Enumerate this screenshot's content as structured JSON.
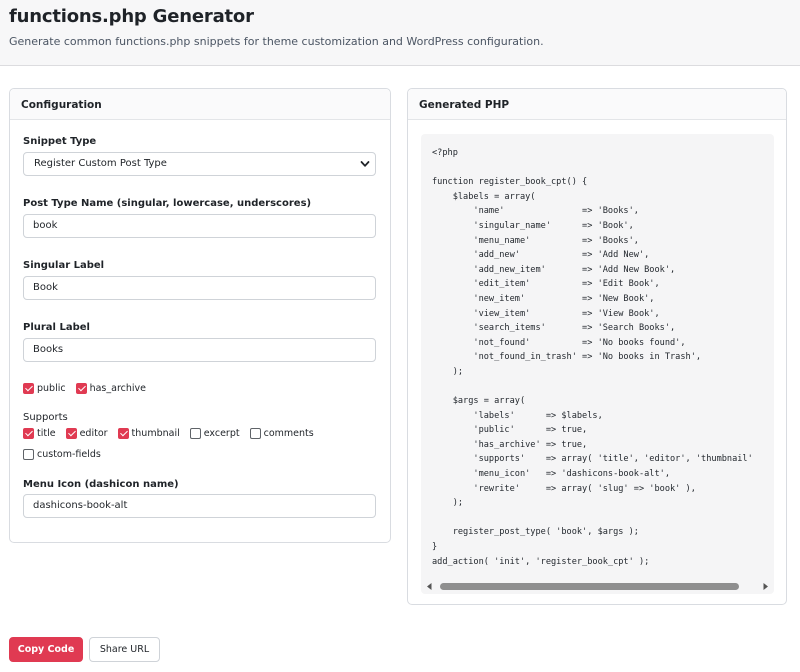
{
  "header": {
    "title": "functions.php Generator",
    "subtitle": "Generate common functions.php snippets for theme customization and WordPress configuration."
  },
  "config": {
    "heading": "Configuration",
    "snippet_type": {
      "label": "Snippet Type",
      "value": "Register Custom Post Type"
    },
    "post_type_name": {
      "label": "Post Type Name (singular, lowercase, underscores)",
      "value": "book"
    },
    "singular_label": {
      "label": "Singular Label",
      "value": "Book"
    },
    "plural_label": {
      "label": "Plural Label",
      "value": "Books"
    },
    "flags": [
      {
        "label": "public",
        "checked": true
      },
      {
        "label": "has_archive",
        "checked": true
      }
    ],
    "supports": {
      "label": "Supports",
      "items": [
        {
          "label": "title",
          "checked": true
        },
        {
          "label": "editor",
          "checked": true
        },
        {
          "label": "thumbnail",
          "checked": true
        },
        {
          "label": "excerpt",
          "checked": false
        },
        {
          "label": "comments",
          "checked": false
        },
        {
          "label": "custom-fields",
          "checked": false
        }
      ]
    },
    "menu_icon": {
      "label": "Menu Icon (dashicon name)",
      "value": "dashicons-book-alt"
    }
  },
  "output": {
    "heading": "Generated PHP",
    "code": "<?php\n\nfunction register_book_cpt() {\n    $labels = array(\n        'name'               => 'Books',\n        'singular_name'      => 'Book',\n        'menu_name'          => 'Books',\n        'add_new'            => 'Add New',\n        'add_new_item'       => 'Add New Book',\n        'edit_item'          => 'Edit Book',\n        'new_item'           => 'New Book',\n        'view_item'          => 'View Book',\n        'search_items'       => 'Search Books',\n        'not_found'          => 'No books found',\n        'not_found_in_trash' => 'No books in Trash',\n    );\n\n    $args = array(\n        'labels'      => $labels,\n        'public'      => true,\n        'has_archive' => true,\n        'supports'    => array( 'title', 'editor', 'thumbnail'\n        'menu_icon'   => 'dashicons-book-alt',\n        'rewrite'     => array( 'slug' => 'book' ),\n    );\n\n    register_post_type( 'book', $args );\n}\nadd_action( 'init', 'register_book_cpt' );"
  },
  "actions": {
    "copy_label": "Copy Code",
    "share_label": "Share URL"
  },
  "colors": {
    "accent": "#e03a52",
    "code_bg": "#f5f5f6"
  }
}
